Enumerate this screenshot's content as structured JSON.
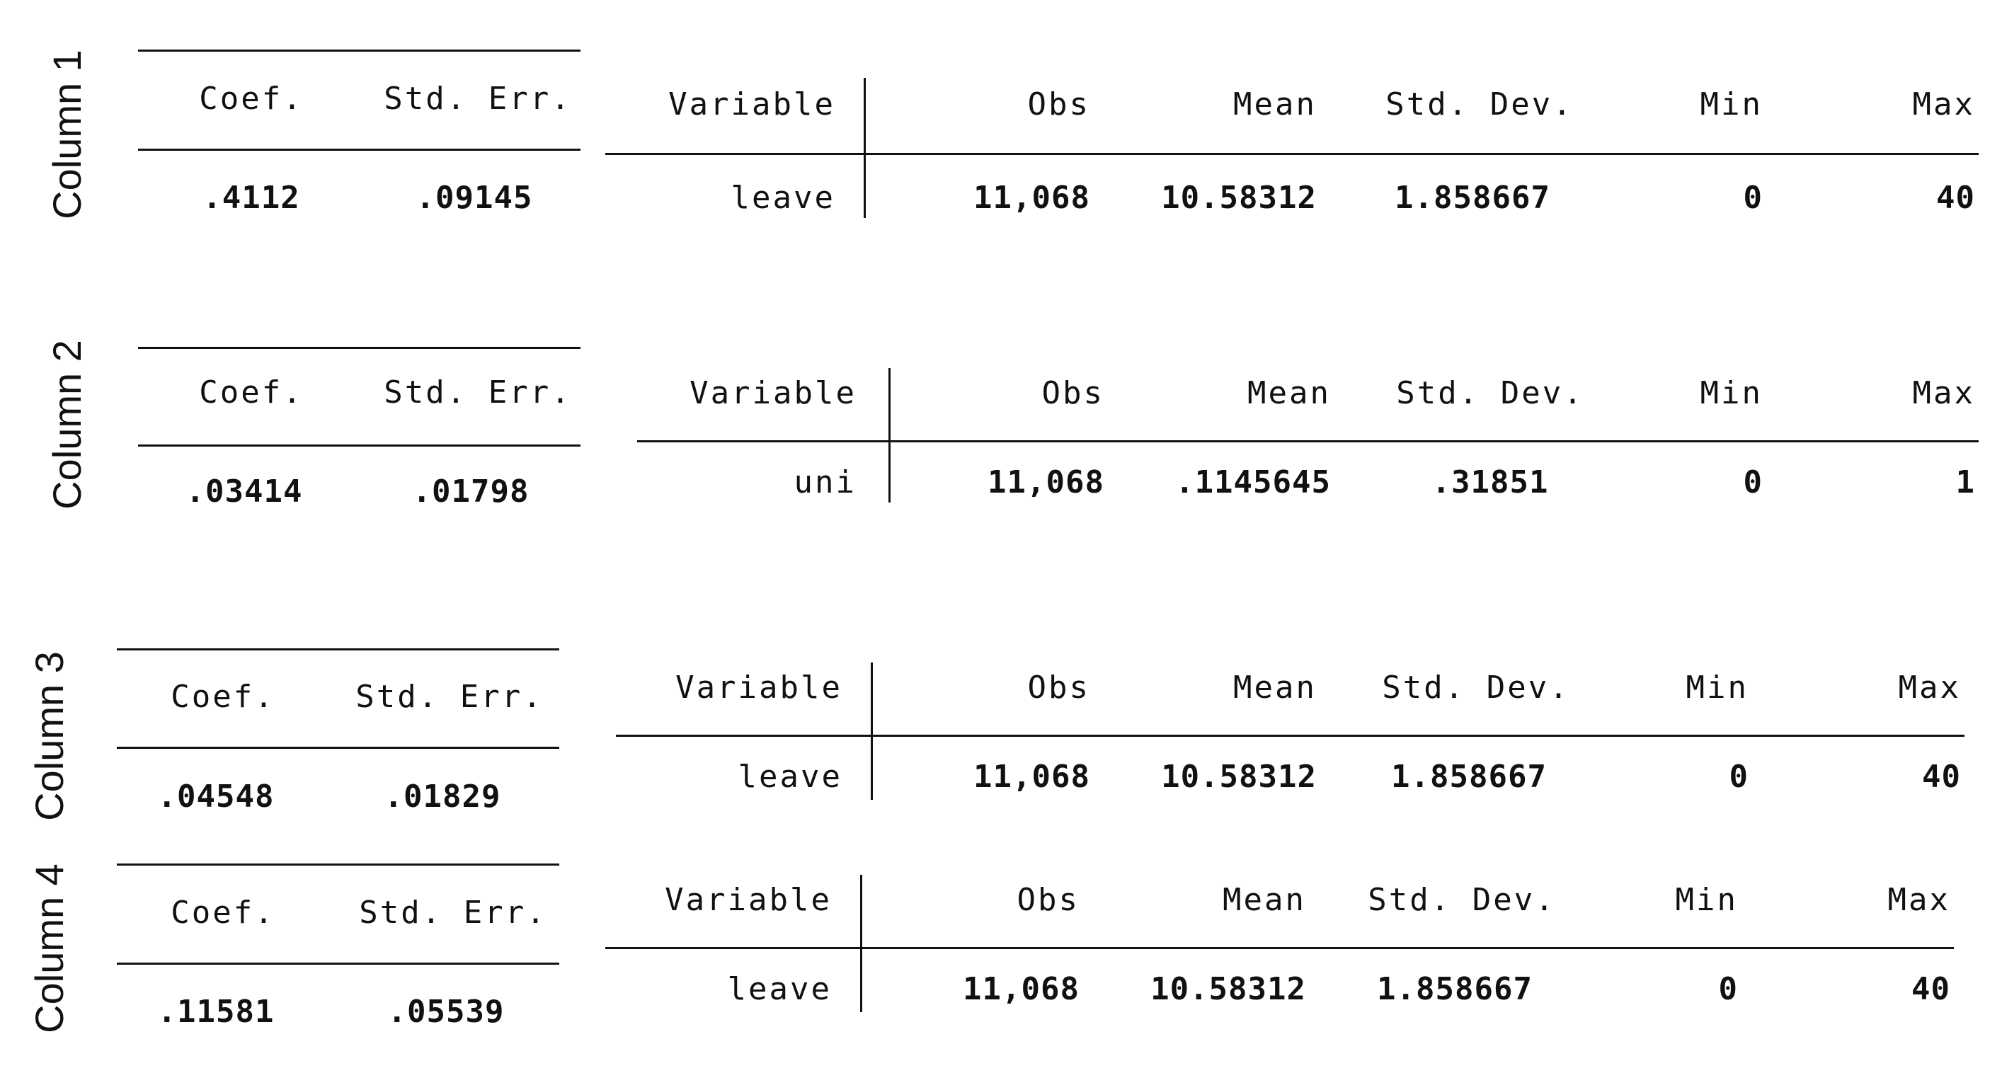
{
  "blocks": [
    {
      "label": "Column 1",
      "coef_header": "Coef.",
      "se_header": "Std. Err.",
      "coef": ".4112",
      "se": ".09145",
      "summary_headers": [
        "Variable",
        "Obs",
        "Mean",
        "Std. Dev.",
        "Min",
        "Max"
      ],
      "summary_values": [
        "leave",
        "11,068",
        "10.58312",
        "1.858667",
        "0",
        "40"
      ]
    },
    {
      "label": "Column 2",
      "coef_header": "Coef.",
      "se_header": "Std. Err.",
      "coef": ".03414",
      "se": ".01798",
      "summary_headers": [
        "Variable",
        "Obs",
        "Mean",
        "Std. Dev.",
        "Min",
        "Max"
      ],
      "summary_values": [
        "uni",
        "11,068",
        ".1145645",
        ".31851",
        "0",
        "1"
      ]
    },
    {
      "label": "Column 3",
      "coef_header": "Coef.",
      "se_header": "Std. Err.",
      "coef": ".04548",
      "se": ".01829",
      "summary_headers": [
        "Variable",
        "Obs",
        "Mean",
        "Std. Dev.",
        "Min",
        "Max"
      ],
      "summary_values": [
        "leave",
        "11,068",
        "10.58312",
        "1.858667",
        "0",
        "40"
      ]
    },
    {
      "label": "Column 4",
      "coef_header": "Coef.",
      "se_header": "Std. Err.",
      "coef": ".11581",
      "se": ".05539",
      "summary_headers": [
        "Variable",
        "Obs",
        "Mean",
        "Std. Dev.",
        "Min",
        "Max"
      ],
      "summary_values": [
        "leave",
        "11,068",
        "10.58312",
        "1.858667",
        "0",
        "40"
      ]
    }
  ]
}
